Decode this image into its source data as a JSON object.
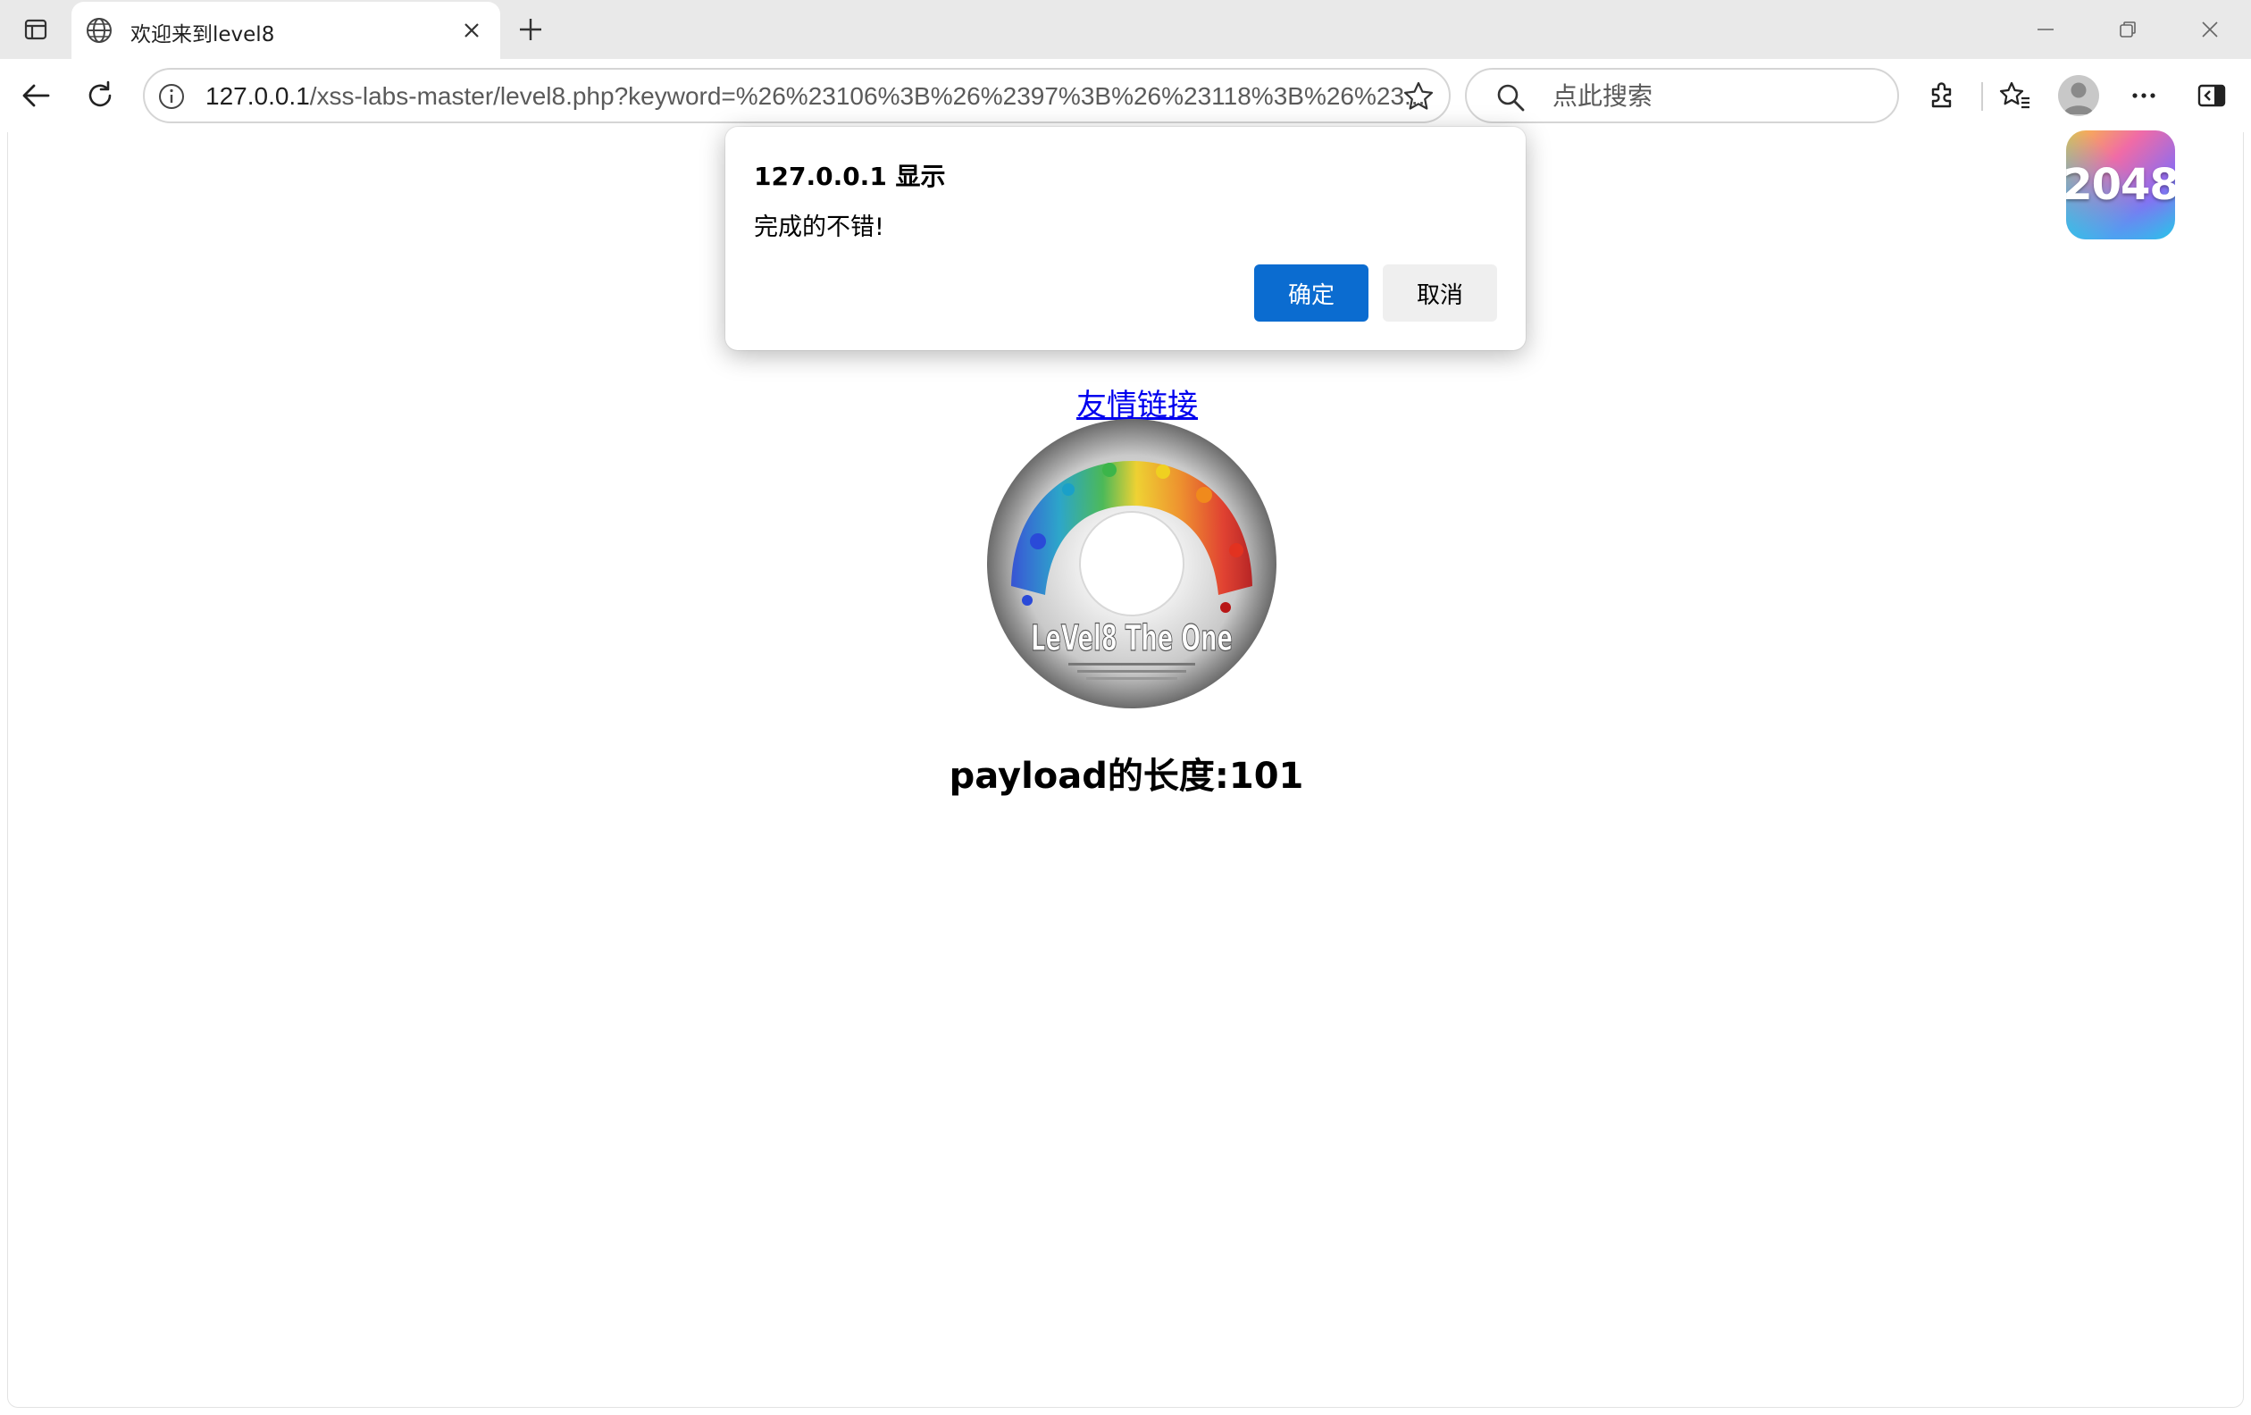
{
  "browser": {
    "tab": {
      "title": "欢迎来到level8",
      "favicon": "globe-icon"
    },
    "address": {
      "host": "127.0.0.1",
      "path": "/xss-labs-master/level8.php?keyword=%26%23106%3B%26%2397%3B%26%23118%3B%26%23..."
    },
    "search": {
      "placeholder": "点此搜索"
    },
    "icons": [
      "tab-actions-icon",
      "close-icon",
      "plus-icon",
      "minimize-icon",
      "restore-icon",
      "close-window-icon",
      "back-arrow-icon",
      "refresh-icon",
      "info-icon",
      "star-icon",
      "search-icon",
      "extensions-icon",
      "favorites-icon",
      "avatar-icon",
      "more-icon",
      "sidebar-icon"
    ]
  },
  "page": {
    "link_text": "友情链接",
    "cd_image": {
      "label": "LeVel8 The One"
    },
    "payload_text": "payload的长度:101",
    "app_icon": {
      "label": "2048"
    }
  },
  "dialog": {
    "title": "127.0.0.1 显示",
    "message": "完成的不错!",
    "ok_label": "确定",
    "cancel_label": "取消"
  },
  "colors": {
    "tabstrip_bg": "#e9e9e9",
    "link": "#0000ee",
    "ok_button": "#0b6cd0",
    "cancel_button": "#efefef"
  }
}
